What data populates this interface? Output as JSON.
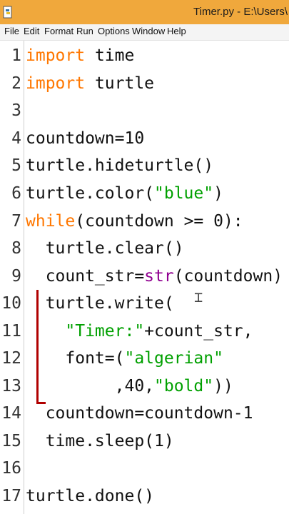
{
  "window": {
    "title": "Timer.py - E:\\Users\\"
  },
  "menu": [
    "File",
    "Edit",
    "Format",
    "Run",
    "Options",
    "Window",
    "Help"
  ],
  "line_numbers": [
    "1",
    "2",
    "3",
    "4",
    "5",
    "6",
    "7",
    "8",
    "9",
    "10",
    "11",
    "12",
    "13",
    "14",
    "15",
    "16",
    "17"
  ],
  "code": {
    "l1_kw": "import",
    "l1_rest": " time",
    "l2_kw": "import",
    "l2_rest": " turtle",
    "l4": "countdown=10",
    "l5": "turtle.hideturtle()",
    "l6_a": "turtle.color(",
    "l6_str": "\"blue\"",
    "l6_b": ")",
    "l7_kw": "while",
    "l7_rest": "(countdown >= 0):",
    "l8": "  turtle.clear()",
    "l9_a": "  count_str=",
    "l9_bi": "str",
    "l9_b": "(countdown)",
    "l10": "  turtle.write(",
    "l11_indent": "    ",
    "l11_str": "\"Timer:\"",
    "l11_rest": "+count_str,",
    "l12_a": "    font=(",
    "l12_str": "\"algerian\"",
    "l13_a": "         ,40,",
    "l13_str": "\"bold\"",
    "l13_b": "))",
    "l14": "  countdown=countdown-1",
    "l15": "  time.sleep(1)",
    "l17": "turtle.done()"
  },
  "colors": {
    "keyword": "#ff7700",
    "string": "#00a000",
    "builtin": "#900090",
    "titlebar": "#f0a83c"
  },
  "icons": {
    "app": "python-idle-icon",
    "cursor": "text-ibeam-cursor-icon"
  }
}
